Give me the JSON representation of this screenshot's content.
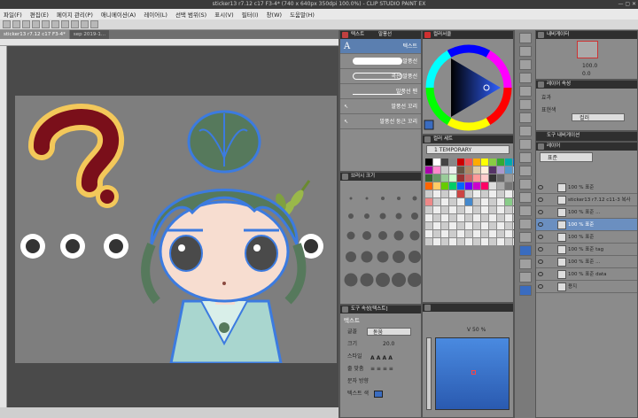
{
  "app": {
    "title": "sticker13 r7.12 c17 F3-4* (740 x 640px 350dpi 100.0%) - CLIP STUDIO PAINT EX"
  },
  "menu": [
    "파일(F)",
    "편집(E)",
    "페이지 관리(P)",
    "애니메이션(A)",
    "레이어(L)",
    "선택 범위(S)",
    "표시(V)",
    "필터(I)",
    "창(W)",
    "도움말(H)"
  ],
  "tabs": [
    "sticker13 r7.12 c17 F3-4*",
    "sep 2019-1..."
  ],
  "canvas": {
    "dots": 4,
    "question_mark": "?"
  },
  "subtool_panel": {
    "tabs": [
      "텍스트",
      "말풍선"
    ],
    "items": [
      {
        "label": "텍스트"
      },
      {
        "label": "타원 말풍선"
      },
      {
        "label": "곡선 말풍선"
      },
      {
        "label": "말풍선 펜"
      },
      {
        "label": "말풍선 꼬리"
      },
      {
        "label": "말풍선 둥근 꼬리"
      }
    ]
  },
  "brush_size_panel": {
    "title": "브러시 크기"
  },
  "color_wheel_panel": {
    "title": "컬러서클"
  },
  "color_set_panel": {
    "title": "컬러 세트",
    "set_name": "1 TEMPORARY"
  },
  "tool_property_panel": {
    "title": "텍스트",
    "header": "도구 속성[텍스트]",
    "rows": [
      {
        "label": "글꼴",
        "value": "돋움"
      },
      {
        "label": "크기",
        "value": "20.0"
      },
      {
        "label": "스타일",
        "value": ""
      },
      {
        "label": "줄 맞춤",
        "value": ""
      },
      {
        "label": "문자 방향",
        "value": ""
      },
      {
        "label": "텍스트 색",
        "value": ""
      }
    ]
  },
  "color_slider_panel": {
    "v_label": "V",
    "v_value": "50 %"
  },
  "navigator_panel": {
    "title": "내비게이터",
    "zoom": "100.0",
    "angle": "0.0"
  },
  "layer_property_panel": {
    "title": "레이어 속성",
    "effect_label": "효과",
    "expression_label": "표현색",
    "expression_value": "컬러"
  },
  "tool_navigation": {
    "title": "도구 내비게이션"
  },
  "layer_panel": {
    "title": "레이어",
    "blend_mode": "표준",
    "layers": [
      {
        "name": "100 % 표준"
      },
      {
        "name": "sticker13 r7.12 c11-3 복사"
      },
      {
        "name": "100 % 표준 ..."
      },
      {
        "name": "100 % 표준"
      },
      {
        "name": "100 % 표준"
      },
      {
        "name": "100 % 표준 tag"
      },
      {
        "name": "100 % 표준 ..."
      },
      {
        "name": "100 % 표준 data"
      },
      {
        "name": "용지"
      }
    ],
    "selected_index": 3
  },
  "colors": {
    "ui_dark": "#2f2f2f",
    "ui_mid": "#8b8b8b",
    "selection": "#6b8fc0",
    "question": "#7a0f1a",
    "question_outline": "#f3c85a"
  }
}
